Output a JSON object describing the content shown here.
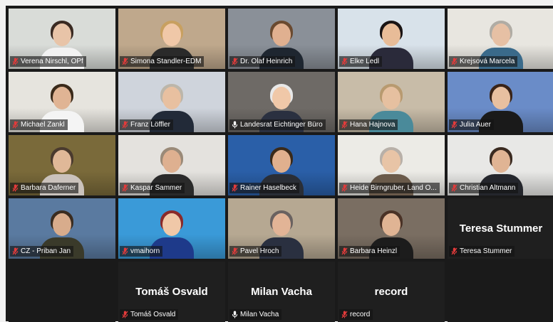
{
  "participants": [
    {
      "name": "Verena Nirschl, OPf",
      "muted": true,
      "bg": "#d9dcd8",
      "skin": "#e8c4a8",
      "hair": "#3a2a22",
      "shirt": "#f2f2f2"
    },
    {
      "name": "Simona Standler-EDM",
      "muted": true,
      "bg": "#bfa88c",
      "skin": "#f0c8a8",
      "hair": "#c8a060",
      "shirt": "#2a2a2a"
    },
    {
      "name": "Dr. Olaf Heinrich",
      "muted": true,
      "bg": "#8a9098",
      "skin": "#e0b090",
      "hair": "#6a4a30",
      "shirt": "#1e2630"
    },
    {
      "name": "Elke Ledl",
      "muted": true,
      "bg": "#d8e2ea",
      "skin": "#e8bc98",
      "hair": "#1a1414",
      "shirt": "#2a2a3a"
    },
    {
      "name": "Krejsová Marcela",
      "muted": true,
      "bg": "#e8e6e0",
      "skin": "#e6c0a4",
      "hair": "#b0aca4",
      "shirt": "#3a6a8a"
    },
    {
      "name": "Michael Zankl",
      "muted": true,
      "bg": "#e6e4de",
      "skin": "#e0b494",
      "hair": "#3a2a1a",
      "shirt": "#f4f4f4"
    },
    {
      "name": "Franz Löffler",
      "muted": true,
      "bg": "#cfd4dc",
      "skin": "#e8c0a0",
      "hair": "#bcb6aa",
      "shirt": "#222a38"
    },
    {
      "name": "Landesrat Eichtinger Büro",
      "muted": false,
      "bg": "#6e6a66",
      "skin": "#f0c8a8",
      "hair": "#e8e8e8",
      "shirt": "#2a3040"
    },
    {
      "name": "Hana Hajnova",
      "muted": true,
      "bg": "#c8bca8",
      "skin": "#e6c0a0",
      "hair": "#b89a70",
      "shirt": "#4a8a9a"
    },
    {
      "name": "Julia Auer",
      "muted": true,
      "bg": "#6a8cc8",
      "skin": "#e8c0a0",
      "hair": "#3a2418",
      "shirt": "#1a1a1a"
    },
    {
      "name": "Barbara Daferner",
      "muted": true,
      "bg": "#7a6a3a",
      "skin": "#e0b898",
      "hair": "#4a3a2e",
      "shirt": "#cac2bc"
    },
    {
      "name": "Kaspar Sammer",
      "muted": true,
      "bg": "#e4e2de",
      "skin": "#deb090",
      "hair": "#9a8a78",
      "shirt": "#2a2a2a"
    },
    {
      "name": "Rainer Haselbeck",
      "muted": true,
      "bg": "#2a5fa8",
      "skin": "#e0b08e",
      "hair": "#3a2a1a",
      "shirt": "#2a2e36"
    },
    {
      "name": "Heide Birngruber, Land O...",
      "muted": true,
      "bg": "#ecebe6",
      "skin": "#e8c4a6",
      "hair": "#b8b0a8",
      "shirt": "#6a5a4a"
    },
    {
      "name": "Christian Altmann",
      "muted": true,
      "bg": "#e8e8e6",
      "skin": "#e0b494",
      "hair": "#3a2a20",
      "shirt": "#24262c"
    },
    {
      "name": "CZ - Priban Jan",
      "muted": true,
      "bg": "#5a7aa0",
      "skin": "#d8ac8c",
      "hair": "#3a2c20",
      "shirt": "#3a3a2a"
    },
    {
      "name": "vmaihorn",
      "muted": true,
      "bg": "#3a9ad8",
      "skin": "#f0c8a8",
      "hair": "#8a2a2a",
      "shirt": "#1e3a8a"
    },
    {
      "name": "Pavel Hroch",
      "muted": true,
      "bg": "#b6a892",
      "skin": "#e2b496",
      "hair": "#6a6260",
      "shirt": "#2a3040"
    },
    {
      "name": "Barbara Heinzl",
      "muted": true,
      "bg": "#7a6e62",
      "skin": "#e0b494",
      "hair": "#4a3226",
      "shirt": "#1c1c1c"
    }
  ],
  "placeholders": [
    {
      "big": "Teresa Stummer",
      "label": "Teresa Stummer",
      "muted": true
    },
    {
      "big": "Tomáš Osvald",
      "label": "Tomáš Osvald",
      "muted": true
    },
    {
      "big": "Milan Vacha",
      "label": "Milan Vacha",
      "muted": false
    },
    {
      "big": "record",
      "label": "record",
      "muted": true
    }
  ],
  "colors": {
    "muted_icon": "#e23b3b",
    "active_border": "#b4e04a"
  }
}
